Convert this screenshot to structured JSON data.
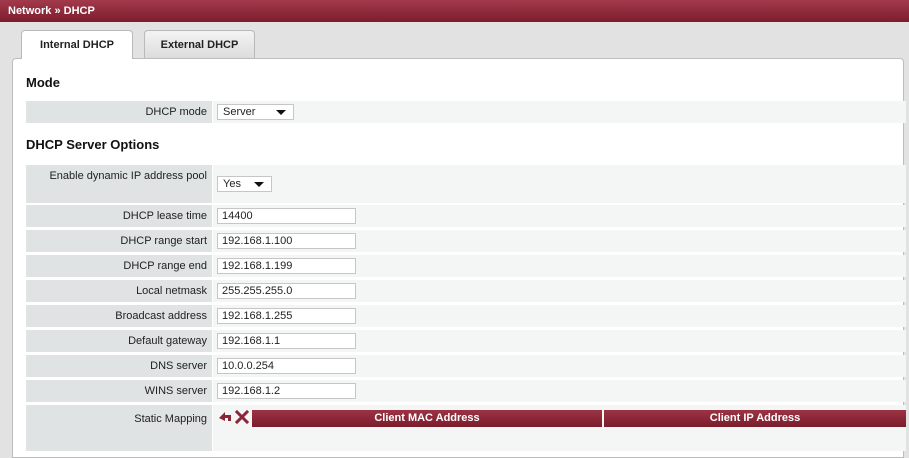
{
  "breadcrumb": "Network » DHCP",
  "tabs": [
    {
      "label": "Internal DHCP",
      "active": true
    },
    {
      "label": "External DHCP",
      "active": false
    }
  ],
  "mode_section": {
    "title": "Mode",
    "dhcp_mode": {
      "label": "DHCP mode",
      "value": "Server"
    }
  },
  "server_section": {
    "title": "DHCP Server Options",
    "dynamic_pool": {
      "label": "Enable dynamic IP address pool",
      "value": "Yes"
    },
    "fields": [
      {
        "label": "DHCP lease time",
        "value": "14400"
      },
      {
        "label": "DHCP range start",
        "value": "192.168.1.100"
      },
      {
        "label": "DHCP range end",
        "value": "192.168.1.199"
      },
      {
        "label": "Local netmask",
        "value": "255.255.255.0"
      },
      {
        "label": "Broadcast address",
        "value": "192.168.1.255"
      },
      {
        "label": "Default gateway",
        "value": "192.168.1.1"
      },
      {
        "label": "DNS server",
        "value": "10.0.0.254"
      },
      {
        "label": "WINS server",
        "value": "192.168.1.2"
      }
    ],
    "static_mapping": {
      "label": "Static Mapping",
      "columns": [
        "Client MAC Address",
        "Client IP Address"
      ],
      "icons": [
        "add-mapping-icon",
        "delete-mapping-icon"
      ]
    }
  },
  "colors": {
    "accent": "#8b2636",
    "row_label_bg": "#dfe3e3",
    "row_field_bg": "#f4f6f6"
  }
}
